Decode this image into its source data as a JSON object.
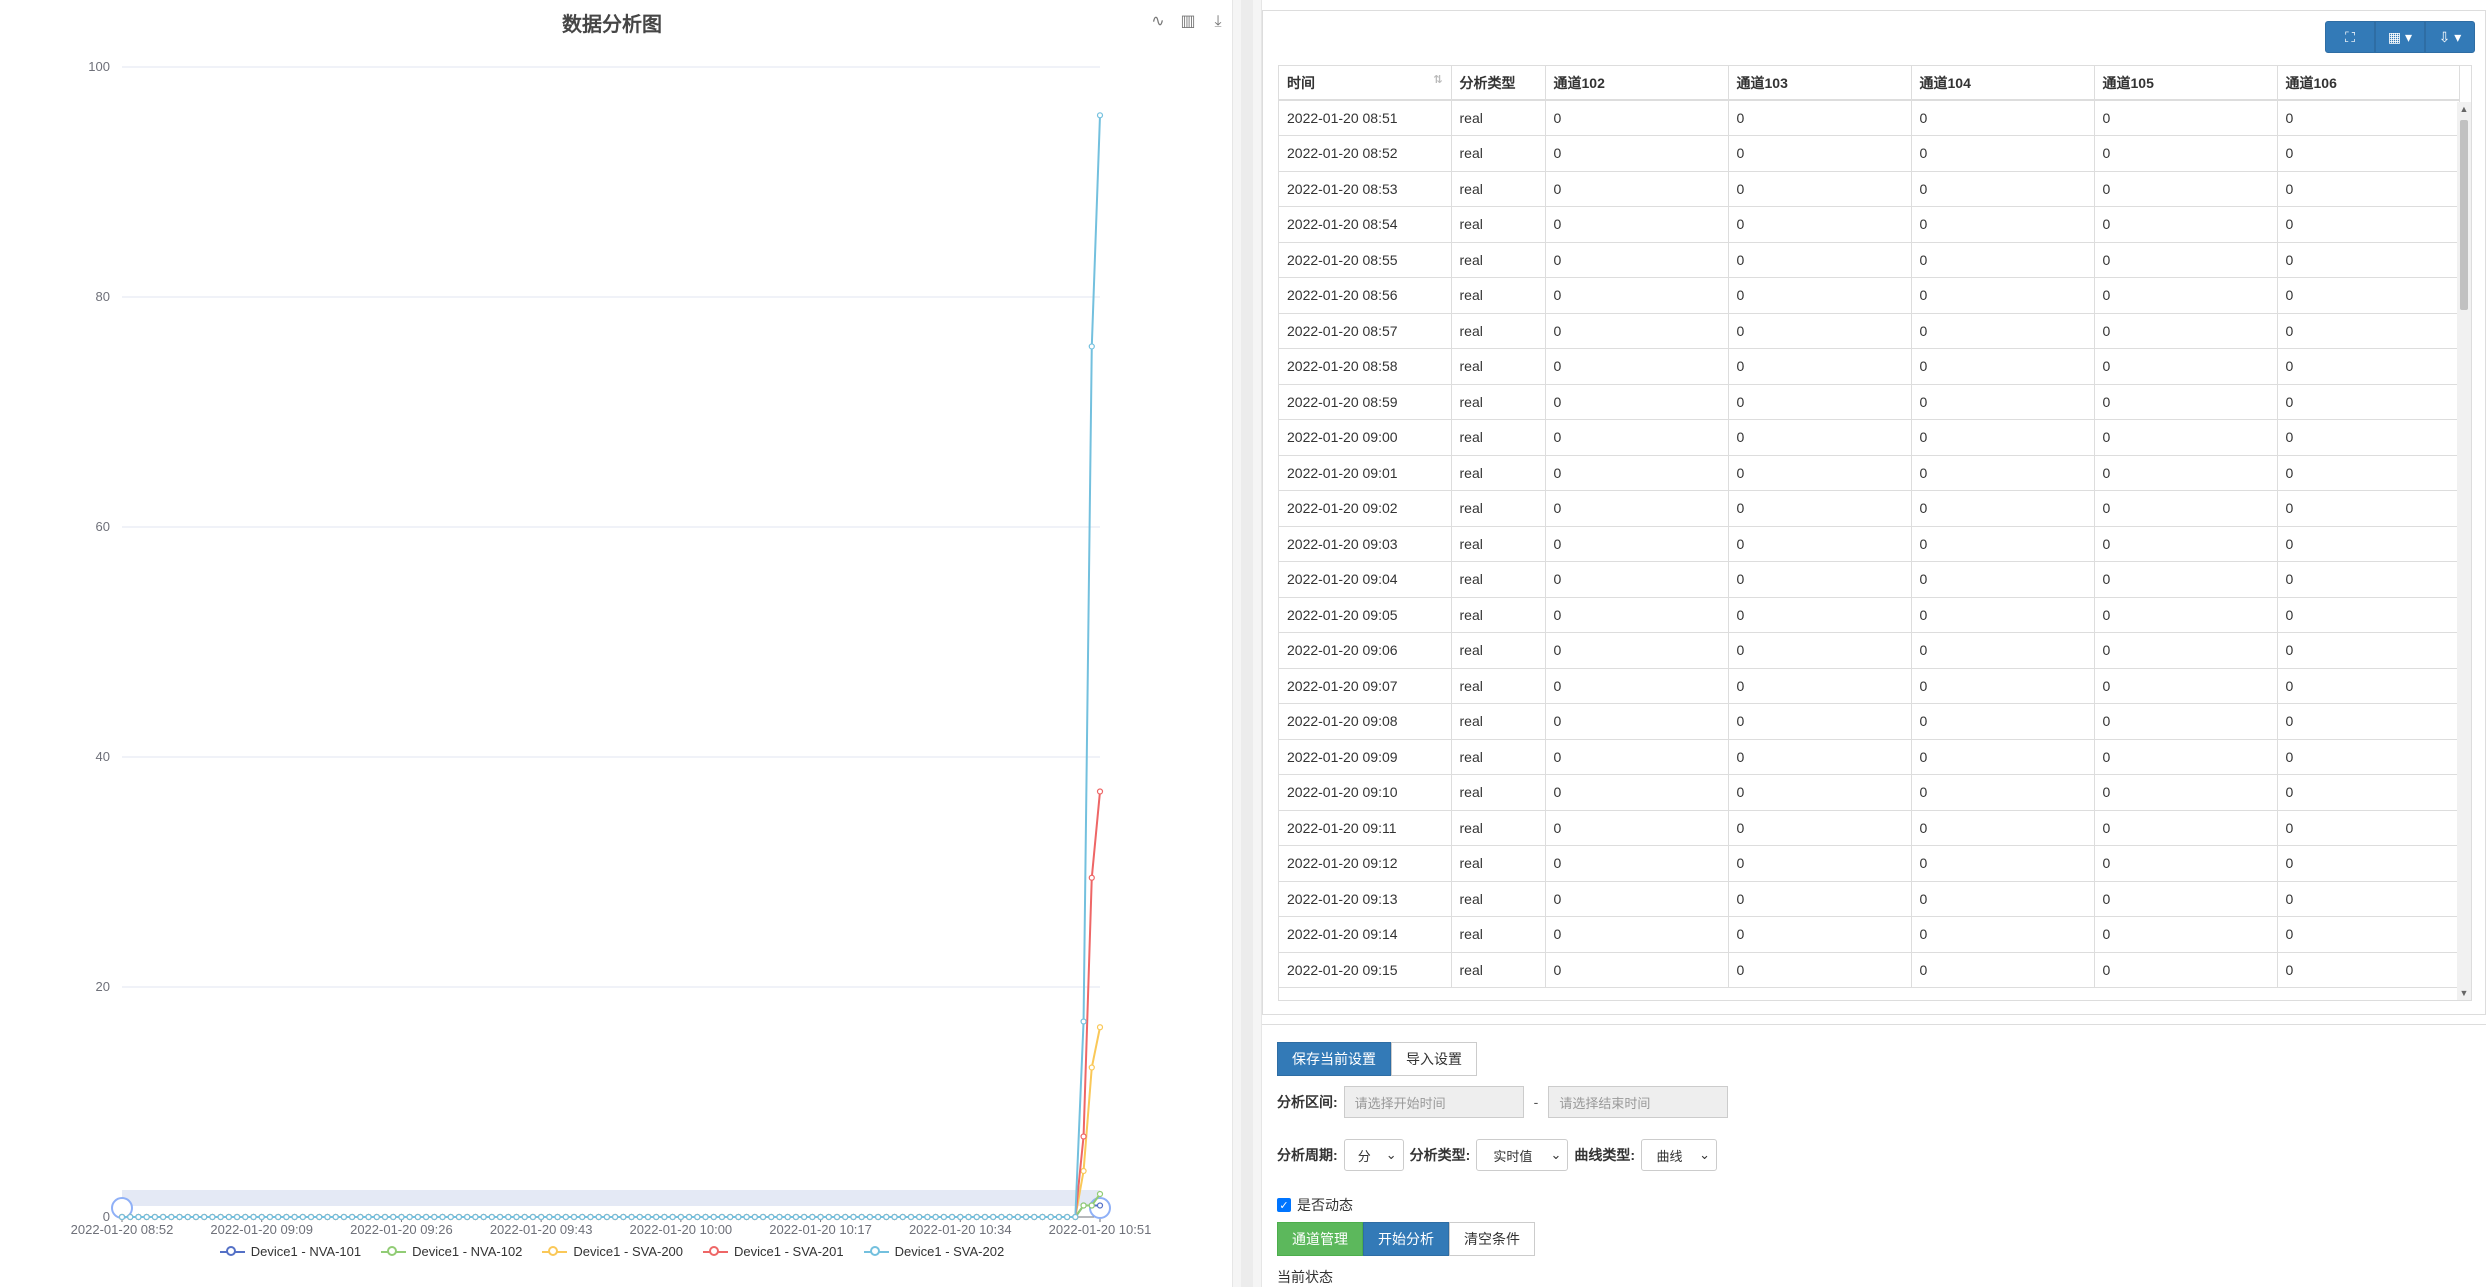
{
  "chart": {
    "title": "数据分析图",
    "tools": [
      {
        "icon": "line-chart-icon",
        "glyph": "∿"
      },
      {
        "icon": "bar-chart-icon",
        "glyph": "▥"
      },
      {
        "icon": "download-icon",
        "glyph": "⤓"
      }
    ]
  },
  "chart_data": {
    "type": "line",
    "title": "数据分析图",
    "xlabel": "",
    "ylabel": "",
    "ylim": [
      0,
      100
    ],
    "y_ticks": [
      0,
      20,
      40,
      60,
      80,
      100
    ],
    "x_ticks": [
      "2022-01-20 08:52",
      "2022-01-20 09:09",
      "2022-01-20 09:26",
      "2022-01-20 09:43",
      "2022-01-20 10:00",
      "2022-01-20 10:17",
      "2022-01-20 10:34",
      "2022-01-20 10:51"
    ],
    "x_start_minute": 0,
    "x_end_minute": 119,
    "grid": true,
    "legend_placement": "bottom",
    "series": [
      {
        "name": "Device1 - NVA-101",
        "color": "#5470c6",
        "tail": [
          [
            116,
            0
          ],
          [
            117,
            1
          ],
          [
            118,
            1
          ],
          [
            119,
            1
          ]
        ]
      },
      {
        "name": "Device1 - NVA-102",
        "color": "#91cc75",
        "tail": [
          [
            116,
            0
          ],
          [
            117,
            1
          ],
          [
            118,
            1
          ],
          [
            119,
            2
          ]
        ]
      },
      {
        "name": "Device1 - SVA-200",
        "color": "#fac858",
        "tail": [
          [
            116,
            0
          ],
          [
            117,
            4
          ],
          [
            118,
            13
          ],
          [
            119,
            16.5
          ]
        ]
      },
      {
        "name": "Device1 - SVA-201",
        "color": "#ee6666",
        "tail": [
          [
            116,
            0
          ],
          [
            117,
            7
          ],
          [
            118,
            29.5
          ],
          [
            119,
            37
          ]
        ]
      },
      {
        "name": "Device1 - SVA-202",
        "color": "#73c0de",
        "tail": [
          [
            116,
            0
          ],
          [
            117,
            17
          ],
          [
            118,
            75.7
          ],
          [
            119,
            95.8
          ]
        ]
      }
    ]
  },
  "table": {
    "toolbar": [
      {
        "icon": "fullscreen-icon",
        "glyph": "⛶"
      },
      {
        "icon": "columns-icon",
        "glyph": "▦ ▾"
      },
      {
        "icon": "export-icon",
        "glyph": "⇩ ▾"
      }
    ],
    "columns": [
      "时间",
      "分析类型",
      "通道102",
      "通道103",
      "通道104",
      "通道105",
      "通道106"
    ],
    "rows": [
      [
        "2022-01-20 08:51",
        "real",
        "0",
        "0",
        "0",
        "0",
        "0"
      ],
      [
        "2022-01-20 08:52",
        "real",
        "0",
        "0",
        "0",
        "0",
        "0"
      ],
      [
        "2022-01-20 08:53",
        "real",
        "0",
        "0",
        "0",
        "0",
        "0"
      ],
      [
        "2022-01-20 08:54",
        "real",
        "0",
        "0",
        "0",
        "0",
        "0"
      ],
      [
        "2022-01-20 08:55",
        "real",
        "0",
        "0",
        "0",
        "0",
        "0"
      ],
      [
        "2022-01-20 08:56",
        "real",
        "0",
        "0",
        "0",
        "0",
        "0"
      ],
      [
        "2022-01-20 08:57",
        "real",
        "0",
        "0",
        "0",
        "0",
        "0"
      ],
      [
        "2022-01-20 08:58",
        "real",
        "0",
        "0",
        "0",
        "0",
        "0"
      ],
      [
        "2022-01-20 08:59",
        "real",
        "0",
        "0",
        "0",
        "0",
        "0"
      ],
      [
        "2022-01-20 09:00",
        "real",
        "0",
        "0",
        "0",
        "0",
        "0"
      ],
      [
        "2022-01-20 09:01",
        "real",
        "0",
        "0",
        "0",
        "0",
        "0"
      ],
      [
        "2022-01-20 09:02",
        "real",
        "0",
        "0",
        "0",
        "0",
        "0"
      ],
      [
        "2022-01-20 09:03",
        "real",
        "0",
        "0",
        "0",
        "0",
        "0"
      ],
      [
        "2022-01-20 09:04",
        "real",
        "0",
        "0",
        "0",
        "0",
        "0"
      ],
      [
        "2022-01-20 09:05",
        "real",
        "0",
        "0",
        "0",
        "0",
        "0"
      ],
      [
        "2022-01-20 09:06",
        "real",
        "0",
        "0",
        "0",
        "0",
        "0"
      ],
      [
        "2022-01-20 09:07",
        "real",
        "0",
        "0",
        "0",
        "0",
        "0"
      ],
      [
        "2022-01-20 09:08",
        "real",
        "0",
        "0",
        "0",
        "0",
        "0"
      ],
      [
        "2022-01-20 09:09",
        "real",
        "0",
        "0",
        "0",
        "0",
        "0"
      ],
      [
        "2022-01-20 09:10",
        "real",
        "0",
        "0",
        "0",
        "0",
        "0"
      ],
      [
        "2022-01-20 09:11",
        "real",
        "0",
        "0",
        "0",
        "0",
        "0"
      ],
      [
        "2022-01-20 09:12",
        "real",
        "0",
        "0",
        "0",
        "0",
        "0"
      ],
      [
        "2022-01-20 09:13",
        "real",
        "0",
        "0",
        "0",
        "0",
        "0"
      ],
      [
        "2022-01-20 09:14",
        "real",
        "0",
        "0",
        "0",
        "0",
        "0"
      ],
      [
        "2022-01-20 09:15",
        "real",
        "0",
        "0",
        "0",
        "0",
        "0"
      ]
    ]
  },
  "controls": {
    "save_settings": "保存当前设置",
    "import_settings": "导入设置",
    "range_label": "分析区间:",
    "start_placeholder": "请选择开始时间",
    "range_separator": "-",
    "end_placeholder": "请选择结束时间",
    "period_label": "分析周期:",
    "period_value": "分",
    "analysis_type_label": "分析类型:",
    "analysis_type_value": "实时值",
    "curve_type_label": "曲线类型:",
    "curve_type_value": "曲线",
    "dynamic_label": "是否动态",
    "channel_manage": "通道管理",
    "start_analysis": "开始分析",
    "clear_conditions": "清空条件",
    "current_status": "当前状态"
  }
}
